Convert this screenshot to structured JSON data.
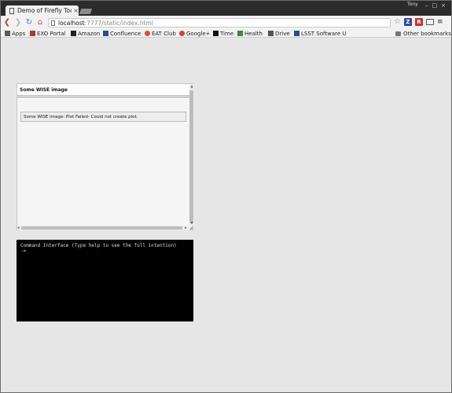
{
  "browser": {
    "tab_title": "Demo of Firefly Tool",
    "tab_close": "×",
    "user_label": "Tony",
    "window_controls": [
      "–",
      "□",
      "×"
    ],
    "url_host": "localhost",
    "url_rest": ":7777/static/index.html",
    "star_glyph": "☆",
    "ext_z": "Z",
    "ext_r": "R",
    "menu_glyph": "≡",
    "nav": {
      "back": "❮",
      "forward": "❯",
      "reload": "↻",
      "home": "⌂"
    }
  },
  "bookmarks": {
    "items": [
      {
        "label": "Apps",
        "color": "#5a5a5a"
      },
      {
        "label": "EXO Portal",
        "color": "#b5352a"
      },
      {
        "label": "Amazon",
        "color": "#222222"
      },
      {
        "label": "Confluence",
        "color": "#2a4ba0"
      },
      {
        "label": "EAT Club",
        "color": "#e24b3b"
      },
      {
        "label": "Google+",
        "color": "#d6432f"
      },
      {
        "label": "Time",
        "color": "#111111"
      },
      {
        "label": "Health",
        "color": "#3a8a3a"
      },
      {
        "label": "Drive",
        "color": "#555555"
      },
      {
        "label": "LSST Software U",
        "color": "#2a4ba0"
      }
    ],
    "other": "Other bookmarks"
  },
  "panel": {
    "title": "Some WISE image",
    "message": "Some WISE image: Plot Failed- Could not create plot."
  },
  "console": {
    "line1": "Command Interface (Type help to see the full intention)",
    "prompt": "->"
  }
}
